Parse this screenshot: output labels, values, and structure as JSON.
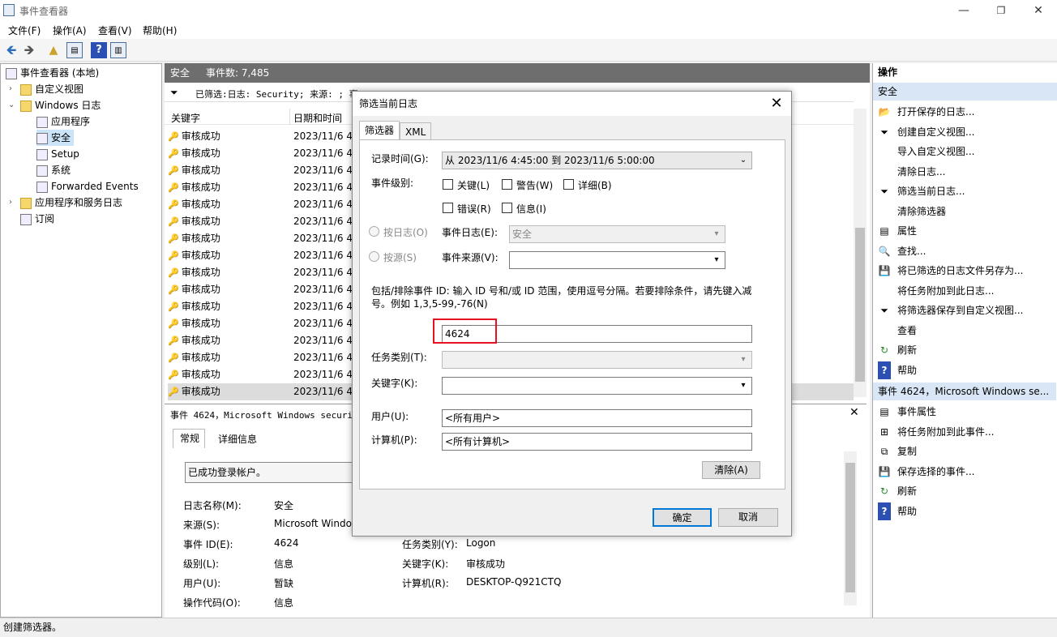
{
  "window": {
    "title": "事件查看器",
    "minimize": "—",
    "maximize": "❐",
    "close": "✕"
  },
  "menu": [
    "文件(F)",
    "操作(A)",
    "查看(V)",
    "帮助(H)"
  ],
  "tree": [
    {
      "label": "事件查看器 (本地)",
      "icon": "event-viewer-icon"
    },
    {
      "label": "自定义视图",
      "icon": "folder-icon"
    },
    {
      "label": "Windows 日志",
      "icon": "folder-icon"
    },
    {
      "label": "应用程序",
      "icon": "log-icon"
    },
    {
      "label": "安全",
      "icon": "log-icon"
    },
    {
      "label": "Setup",
      "icon": "log-icon"
    },
    {
      "label": "系统",
      "icon": "log-icon"
    },
    {
      "label": "Forwarded Events",
      "icon": "log-icon"
    },
    {
      "label": "应用程序和服务日志",
      "icon": "folder-icon"
    },
    {
      "label": "订阅",
      "icon": "subscription-icon"
    }
  ],
  "center": {
    "log_name": "安全",
    "event_count": "事件数: 7,485",
    "filter_text": "已筛选:日志: Security; 来源: ; 事",
    "col_keyword": "关键字",
    "col_datetime": "日期和时间",
    "rows": [
      {
        "key": "审核成功",
        "dt": "2023/11/6 4:"
      },
      {
        "key": "审核成功",
        "dt": "2023/11/6 4:"
      },
      {
        "key": "审核成功",
        "dt": "2023/11/6 4:"
      },
      {
        "key": "审核成功",
        "dt": "2023/11/6 4:"
      },
      {
        "key": "审核成功",
        "dt": "2023/11/6 4:"
      },
      {
        "key": "审核成功",
        "dt": "2023/11/6 4:"
      },
      {
        "key": "审核成功",
        "dt": "2023/11/6 4:"
      },
      {
        "key": "审核成功",
        "dt": "2023/11/6 4:"
      },
      {
        "key": "审核成功",
        "dt": "2023/11/6 4:"
      },
      {
        "key": "审核成功",
        "dt": "2023/11/6 4:"
      },
      {
        "key": "审核成功",
        "dt": "2023/11/6 4:"
      },
      {
        "key": "审核成功",
        "dt": "2023/11/6 4:"
      },
      {
        "key": "审核成功",
        "dt": "2023/11/6 4:"
      },
      {
        "key": "审核成功",
        "dt": "2023/11/6 4:"
      },
      {
        "key": "审核成功",
        "dt": "2023/11/6 4:"
      },
      {
        "key": "审核成功",
        "dt": "2023/11/6 4:"
      }
    ],
    "detail_title": "事件 4624，Microsoft Windows security",
    "detail_tabs": [
      "常规",
      "详细信息"
    ],
    "detail_desc": "已成功登录帐户。",
    "detail_fields": {
      "log_name_lbl": "日志名称(M):",
      "log_name": "安全",
      "source_lbl": "来源(S):",
      "source": "Microsoft Windo",
      "event_id_lbl": "事件 ID(E):",
      "event_id": "4624",
      "level_lbl": "级别(L):",
      "level": "信息",
      "user_lbl": "用户(U):",
      "user": "暂缺",
      "opcode_lbl": "操作代码(O):",
      "opcode": "信息",
      "task_lbl": "任务类别(Y):",
      "task": "Logon",
      "keywords_lbl": "关键字(K):",
      "keywords": "审核成功",
      "computer_lbl": "计算机(R):",
      "computer": "DESKTOP-Q921CTQ"
    }
  },
  "actions": {
    "header": "操作",
    "section1": "安全",
    "items1": [
      {
        "label": "打开保存的日志...",
        "icon": "open-folder-icon"
      },
      {
        "label": "创建自定义视图...",
        "icon": "filter-icon"
      },
      {
        "label": "导入自定义视图...",
        "icon": ""
      },
      {
        "label": "清除日志...",
        "icon": ""
      },
      {
        "label": "筛选当前日志...",
        "icon": "filter-icon"
      },
      {
        "label": "清除筛选器",
        "icon": ""
      },
      {
        "label": "属性",
        "icon": "properties-icon"
      },
      {
        "label": "查找...",
        "icon": "find-icon"
      },
      {
        "label": "将已筛选的日志文件另存为...",
        "icon": "save-icon"
      },
      {
        "label": "将任务附加到此日志...",
        "icon": ""
      },
      {
        "label": "将筛选器保存到自定义视图...",
        "icon": "filter-save-icon"
      },
      {
        "label": "查看",
        "icon": ""
      },
      {
        "label": "刷新",
        "icon": "refresh-icon"
      },
      {
        "label": "帮助",
        "icon": "help-icon"
      }
    ],
    "section2": "事件 4624，Microsoft Windows se...",
    "items2": [
      {
        "label": "事件属性",
        "icon": "properties-icon"
      },
      {
        "label": "将任务附加到此事件...",
        "icon": "task-icon"
      },
      {
        "label": "复制",
        "icon": "copy-icon"
      },
      {
        "label": "保存选择的事件...",
        "icon": "save-icon"
      },
      {
        "label": "刷新",
        "icon": "refresh-icon"
      },
      {
        "label": "帮助",
        "icon": "help-icon"
      }
    ]
  },
  "status": "创建筛选器。",
  "dialog": {
    "title": "筛选当前日志",
    "tabs": [
      "筛选器",
      "XML"
    ],
    "logged_lbl": "记录时间(G):",
    "logged_value": "从 2023/11/6 4:45:00 到 2023/11/6 5:00:00",
    "level_lbl": "事件级别:",
    "levels": [
      "关键(L)",
      "警告(W)",
      "详细(B)",
      "错误(R)",
      "信息(I)"
    ],
    "by_log": "按日志(O)",
    "by_source": "按源(S)",
    "event_logs_lbl": "事件日志(E):",
    "event_logs_value": "安全",
    "event_sources_lbl": "事件来源(V):",
    "event_sources_value": "",
    "id_hint": "包括/排除事件 ID: 输入 ID 号和/或 ID 范围，使用逗号分隔。若要排除条件，请先键入减号。例如 1,3,5-99,-76(N)",
    "event_id_value": "4624",
    "task_lbl": "任务类别(T):",
    "keywords_lbl": "关键字(K):",
    "user_lbl": "用户(U):",
    "user_value": "<所有用户>",
    "computer_lbl": "计算机(P):",
    "computer_value": "<所有计算机>",
    "clear_btn": "清除(A)",
    "ok_btn": "确定",
    "cancel_btn": "取消",
    "highlight_color": "#e81123"
  }
}
